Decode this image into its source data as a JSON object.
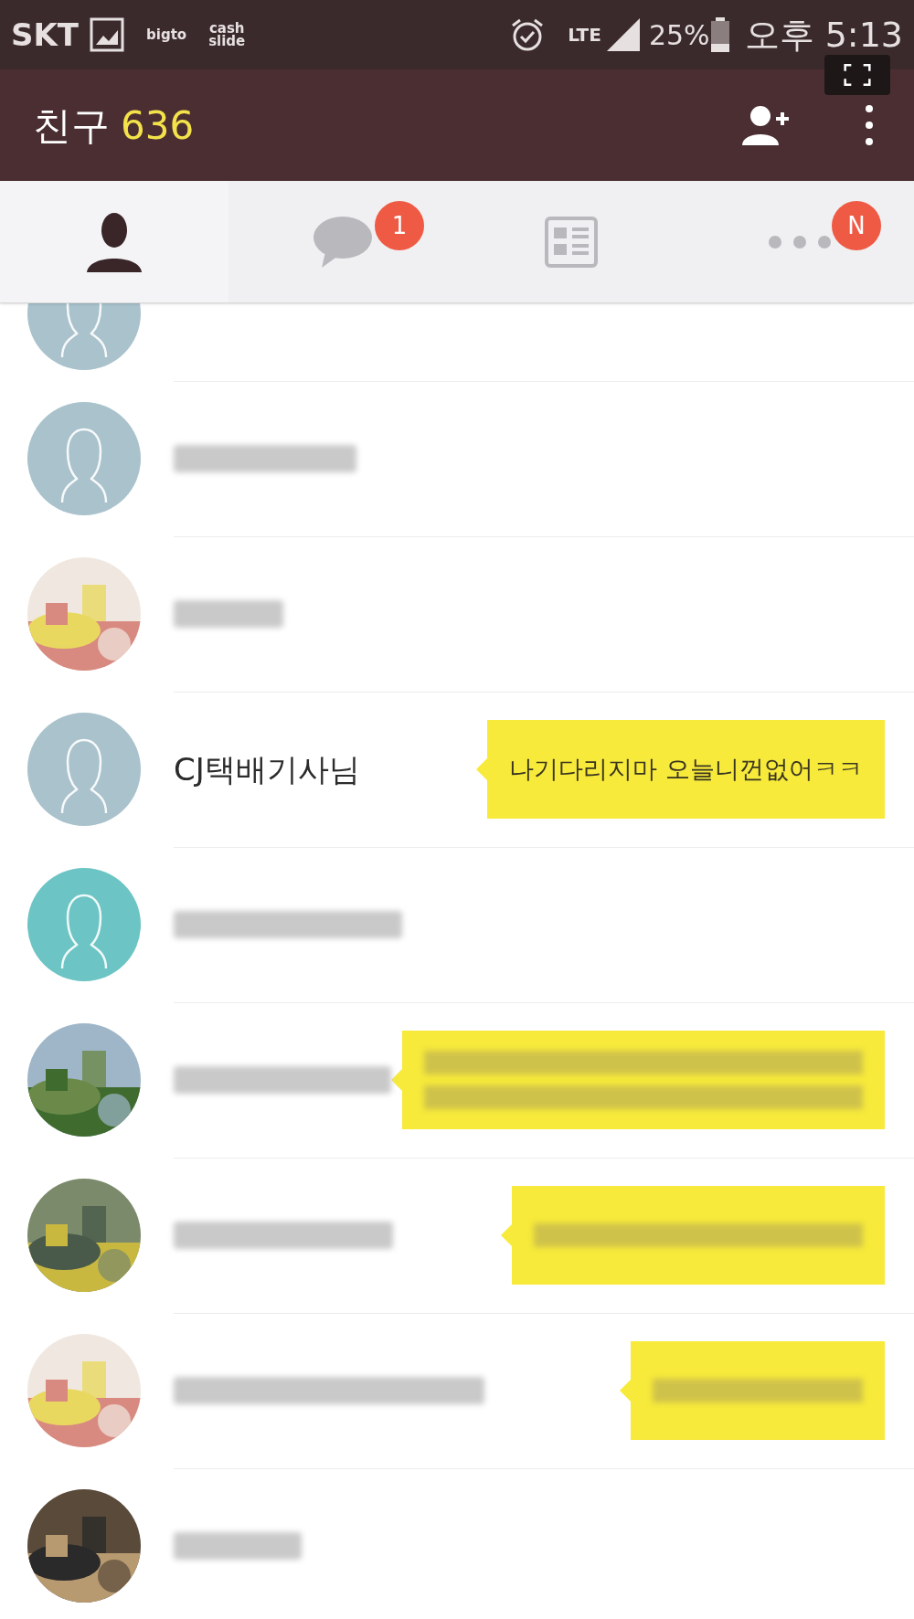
{
  "status_bar": {
    "carrier": "SKT",
    "app_labels": [
      "bigto",
      "cash\nslide"
    ],
    "network": "LTE",
    "battery": "25%",
    "time": "오후 5:13"
  },
  "header": {
    "title": "친구",
    "count": "636"
  },
  "tabs": [
    {
      "kind": "friends",
      "selected": true
    },
    {
      "kind": "chats",
      "selected": false,
      "badge": "1"
    },
    {
      "kind": "news",
      "selected": false
    },
    {
      "kind": "more",
      "selected": false,
      "badge": "N"
    }
  ],
  "friends": [
    {
      "kind": "silhouette",
      "color": "#a9c2cc",
      "cut_off": true
    },
    {
      "kind": "silhouette",
      "color": "#a9c2cc",
      "name_blurred": true
    },
    {
      "kind": "picture",
      "name_blurred": true
    },
    {
      "kind": "silhouette",
      "color": "#a9c2cc",
      "name": "CJ택배기사님",
      "status": "나기다리지마 오늘니껀없어ㅋㅋ"
    },
    {
      "kind": "silhouette",
      "color": "#6cc4c4",
      "name_blurred": true
    },
    {
      "kind": "picture",
      "name_blurred": true,
      "status_blurred": true
    },
    {
      "kind": "picture",
      "name_blurred": true,
      "status_blurred": true
    },
    {
      "kind": "picture",
      "name_blurred": true,
      "status_blurred": true
    },
    {
      "kind": "picture",
      "name_blurred": true
    }
  ]
}
